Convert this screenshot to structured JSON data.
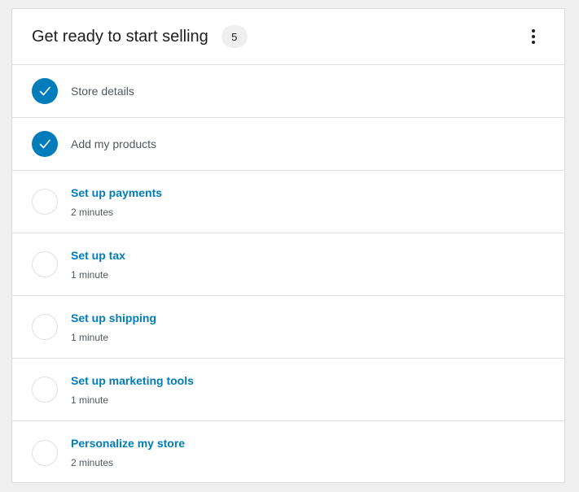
{
  "header": {
    "title": "Get ready to start selling",
    "count": "5"
  },
  "tasks": [
    {
      "title": "Store details",
      "completed": true
    },
    {
      "title": "Add my products",
      "completed": true
    },
    {
      "title": "Set up payments",
      "time": "2 minutes",
      "completed": false
    },
    {
      "title": "Set up tax",
      "time": "1 minute",
      "completed": false
    },
    {
      "title": "Set up shipping",
      "time": "1 minute",
      "completed": false
    },
    {
      "title": "Set up marketing tools",
      "time": "1 minute",
      "completed": false
    },
    {
      "title": "Personalize my store",
      "time": "2 minutes",
      "completed": false
    }
  ],
  "colors": {
    "accent": "#007cba",
    "text": "#1e1e1e",
    "muted": "#50575e",
    "border": "#e0e0e0"
  }
}
